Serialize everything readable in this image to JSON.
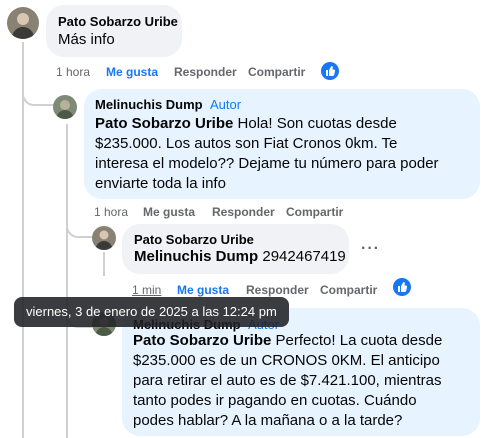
{
  "comments": [
    {
      "author": "Pato Sobarzo Uribe",
      "text": "Más info",
      "actions": {
        "time": "1 hora",
        "like": "Me gusta",
        "reply": "Responder",
        "share": "Compartir"
      }
    },
    {
      "author": "Melinuchis Dump",
      "author_tag": "Autor",
      "mention": "Pato Sobarzo Uribe",
      "lines": [
        " Hola! Son cuotas desde",
        "$235.000. Los autos son Fiat Cronos 0km. Te",
        "interesa el modelo?? Dejame tu número para poder",
        "enviarte toda la info"
      ],
      "actions": {
        "time": "1 hora",
        "like": "Me gusta",
        "reply": "Responder",
        "share": "Compartir"
      }
    },
    {
      "author": "Pato Sobarzo Uribe",
      "mention": "Melinuchis Dump",
      "text": " 2942467419",
      "more": "···",
      "actions": {
        "time": "1 min",
        "like": "Me gusta",
        "reply": "Responder",
        "share": "Compartir"
      }
    },
    {
      "author": "Melinuchis Dump",
      "author_tag": "Autor",
      "mention": "Pato Sobarzo Uribe",
      "lines": [
        " Perfecto! La cuota desde",
        "$235.000 es de un CRONOS 0KM. El anticipo",
        "para retirar el auto es de $7.421.100, mientras",
        "tanto podes ir pagando en cuotas. Cuándo",
        "podes hablar? A la mañana o a la tarde?"
      ]
    }
  ],
  "tooltip": "viernes, 3 de enero de 2025 a las 12:24 pm",
  "colors": {
    "accent": "#1877f2",
    "bubble_gray": "#f0f2f5",
    "bubble_blue": "#e7f3ff",
    "secondary_text": "#65676b"
  },
  "icons": {
    "reaction": "thumbs-up-icon",
    "avatar": "avatar"
  }
}
